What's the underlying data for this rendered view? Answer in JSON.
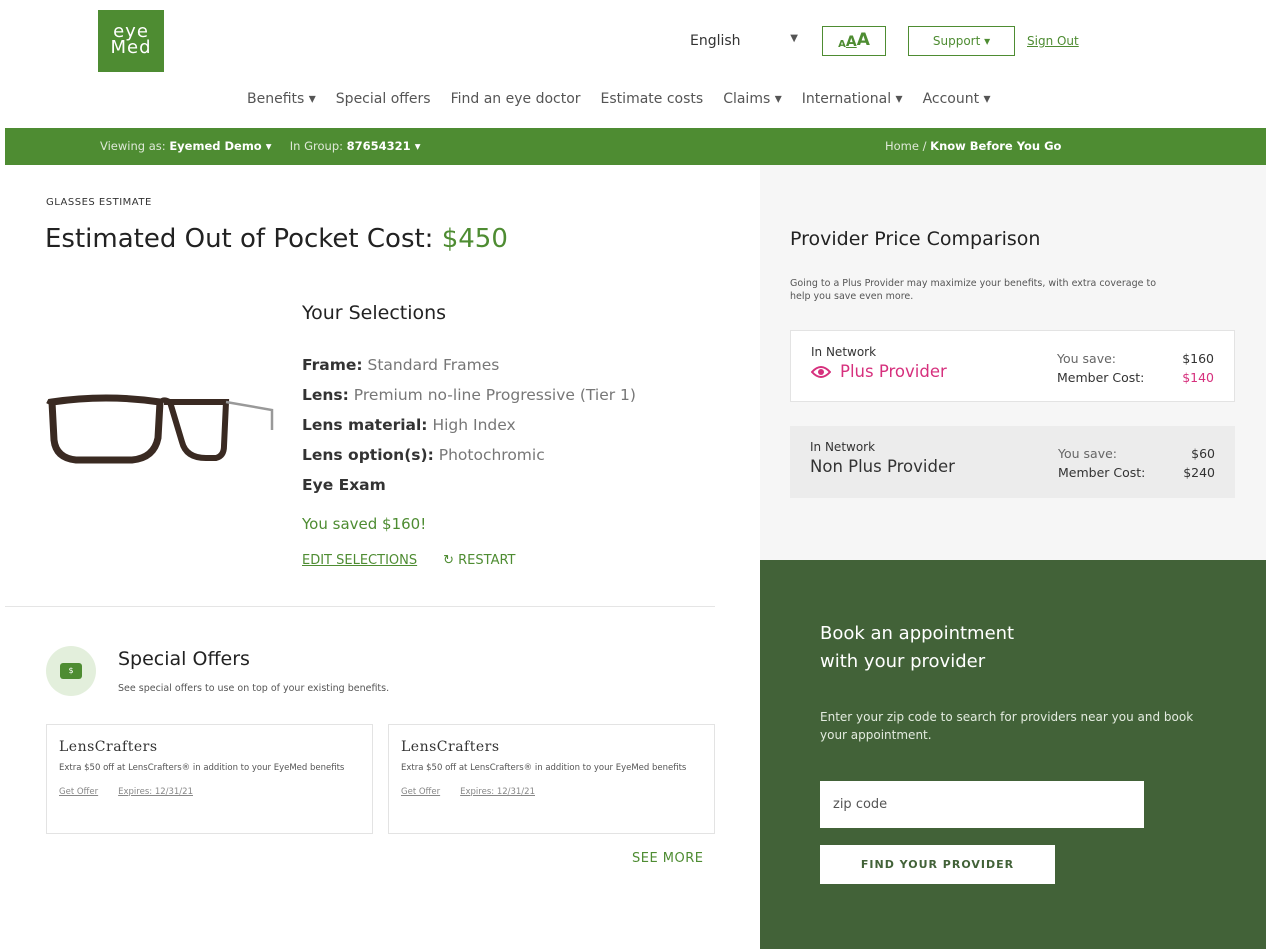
{
  "brand": {
    "logo_line1": "eye",
    "logo_line2": "Med",
    "color": "#4e8c32"
  },
  "utility": {
    "language": "English",
    "text_size": [
      "A",
      "A",
      "A"
    ],
    "support": "Support ▾",
    "sign_out": "Sign Out"
  },
  "nav": [
    "Benefits ▾",
    "Special offers",
    "Find an eye doctor",
    "Estimate costs",
    "Claims ▾",
    "International ▾",
    "Account ▾"
  ],
  "context_bar": {
    "viewing_label": "Viewing as:",
    "viewing_value": "Eyemed Demo ▾",
    "group_label": "In Group:",
    "group_value": "87654321 ▾",
    "breadcrumb_home": "Home /",
    "breadcrumb_current": "Know Before You Go"
  },
  "estimate": {
    "eyebrow": "GLASSES ESTIMATE",
    "headline": "Estimated Out of Pocket Cost:",
    "amount": "$450"
  },
  "selections": {
    "title": "Your Selections",
    "items": [
      {
        "label": "Frame:",
        "value": "Standard Frames"
      },
      {
        "label": "Lens:",
        "value": "Premium no-line Progressive (Tier 1)"
      },
      {
        "label": "Lens material:",
        "value": "High Index"
      },
      {
        "label": "Lens option(s):",
        "value": "Photochromic"
      },
      {
        "label": "Eye Exam",
        "value": ""
      }
    ],
    "saved": "You saved $160!",
    "edit": "EDIT SELECTIONS",
    "restart": "↻ RESTART"
  },
  "offers": {
    "title": "Special Offers",
    "subtitle": "See special offers to use on top of your existing benefits.",
    "icon_label": "$",
    "cards": [
      {
        "brand": "LensCrafters",
        "desc": "Extra $50 off at LensCrafters® in addition to your EyeMed benefits",
        "get": "Get Offer",
        "expires": "Expires: 12/31/21"
      },
      {
        "brand": "LensCrafters",
        "desc": "Extra $50 off at LensCrafters® in addition to your EyeMed benefits",
        "get": "Get Offer",
        "expires": "Expires: 12/31/21"
      }
    ],
    "see_more": "SEE MORE"
  },
  "comparison": {
    "title": "Provider Price Comparison",
    "subtitle": "Going to a Plus Provider may maximize your benefits, with extra coverage to help you save even more.",
    "providers": [
      {
        "network": "In Network",
        "name": "Plus Provider",
        "save_label": "You save:",
        "save": "$160",
        "cost_label": "Member Cost:",
        "cost": "$140"
      },
      {
        "network": "In Network",
        "name": "Non Plus Provider",
        "save_label": "You save:",
        "save": "$60",
        "cost_label": "Member Cost:",
        "cost": "$240"
      }
    ]
  },
  "book": {
    "title_line1": "Book an appointment",
    "title_line2": "with your provider",
    "subtitle": "Enter your zip code to search for providers near you and book your appointment.",
    "zip_placeholder": "zip code",
    "button": "FIND YOUR PROVIDER"
  }
}
